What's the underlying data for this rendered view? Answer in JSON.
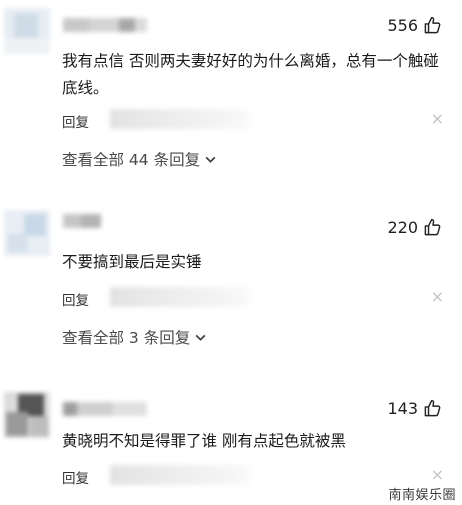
{
  "comments": [
    {
      "likes": "556",
      "text": "我有点信 否则两夫妻好好的为什么离婚，总有一个触碰底线。",
      "reply_label": "回复",
      "close_symbol": "×",
      "view_all": "查看全部 44 条回复"
    },
    {
      "likes": "220",
      "text": "不要搞到最后是实锤",
      "reply_label": "回复",
      "close_symbol": "×",
      "view_all": "查看全部 3 条回复"
    },
    {
      "likes": "143",
      "text": "黄晓明不知是得罪了谁 刚有点起色就被黑",
      "reply_label": "回复",
      "close_symbol": "×"
    }
  ],
  "watermark": "南南娱乐圈",
  "colors": {
    "text": "#1a1a1a",
    "secondary": "#4a4a4a",
    "close": "#c4c4c4"
  },
  "icons": {
    "like": "thumbs-up-outline-icon",
    "expand": "chevron-down-icon",
    "close": "close-icon"
  }
}
